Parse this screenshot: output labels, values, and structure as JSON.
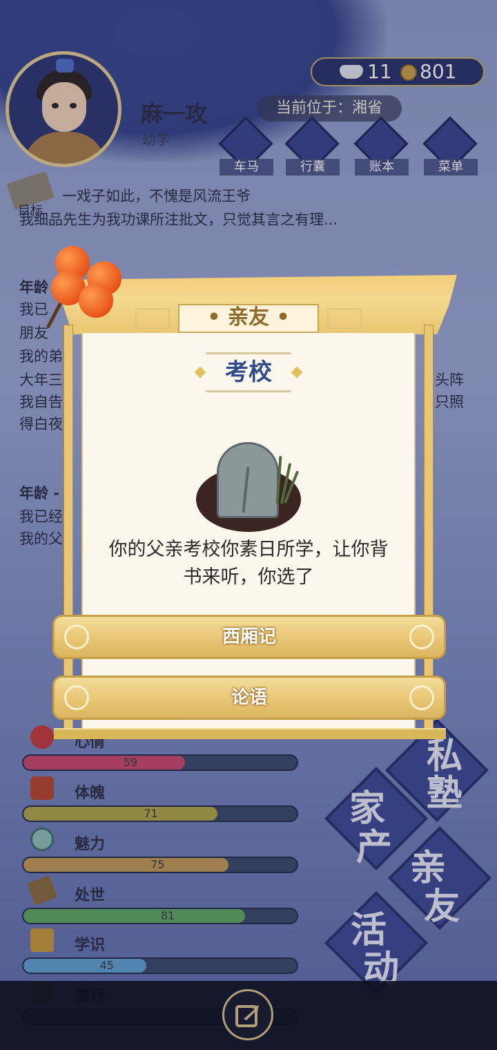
{
  "player": {
    "name": "麻一攻",
    "age_stage": "幼学",
    "location_prefix": "当前位于：",
    "location": "湘省"
  },
  "currency": {
    "ingot_count": "11",
    "coin_count": "801"
  },
  "nav": [
    {
      "label": "车马",
      "icon": "carriage-icon"
    },
    {
      "label": "行囊",
      "icon": "bag-icon"
    },
    {
      "label": "账本",
      "icon": "ledger-icon"
    },
    {
      "label": "菜单",
      "icon": "menu-icon"
    }
  ],
  "goal": {
    "label": "目标"
  },
  "log": {
    "line1": "一戏子如此，不愧是风流王爷",
    "line2": "我细品先生为我功课所注批文，只觉其言之有理...",
    "year_heading_1": "年龄",
    "fragments_left_1": [
      "我已",
      "朋友",
      "我的弟",
      "大年三",
      "我自告",
      "得白夜"
    ],
    "fragments_right_1": [
      "头阵",
      "只照"
    ],
    "year_heading_2": "年龄 -",
    "fragments_left_2": [
      "我已经",
      "我的父"
    ]
  },
  "modal": {
    "tab_title": "亲友",
    "event_title": "考校",
    "event_text": "你的父亲考校你素日所学，让你背书来听，你选了",
    "choices": [
      {
        "label": "西厢记"
      },
      {
        "label": "论语"
      }
    ]
  },
  "stats": [
    {
      "label": "心情",
      "value": 59,
      "color": "#c9476b",
      "icon": "flower-icon"
    },
    {
      "label": "体魄",
      "value": 71,
      "color": "#b2a64a",
      "icon": "body-icon"
    },
    {
      "label": "魅力",
      "value": 75,
      "color": "#c49a55",
      "icon": "charm-icon"
    },
    {
      "label": "处世",
      "value": 81,
      "color": "#5ea85e",
      "icon": "worldly-icon"
    },
    {
      "label": "学识",
      "value": 45,
      "color": "#5fa0d0",
      "icon": "books-icon"
    },
    {
      "label": "德行",
      "value": 0,
      "color": "#3d2a4a",
      "icon": "virtue-icon"
    }
  ],
  "actions": [
    {
      "label": "私塾",
      "chars": [
        "私",
        "塾"
      ]
    },
    {
      "label": "家产",
      "chars": [
        "家",
        "产"
      ]
    },
    {
      "label": "亲友",
      "chars": [
        "亲",
        "友"
      ]
    },
    {
      "label": "活动",
      "chars": [
        "活",
        "动"
      ]
    }
  ]
}
